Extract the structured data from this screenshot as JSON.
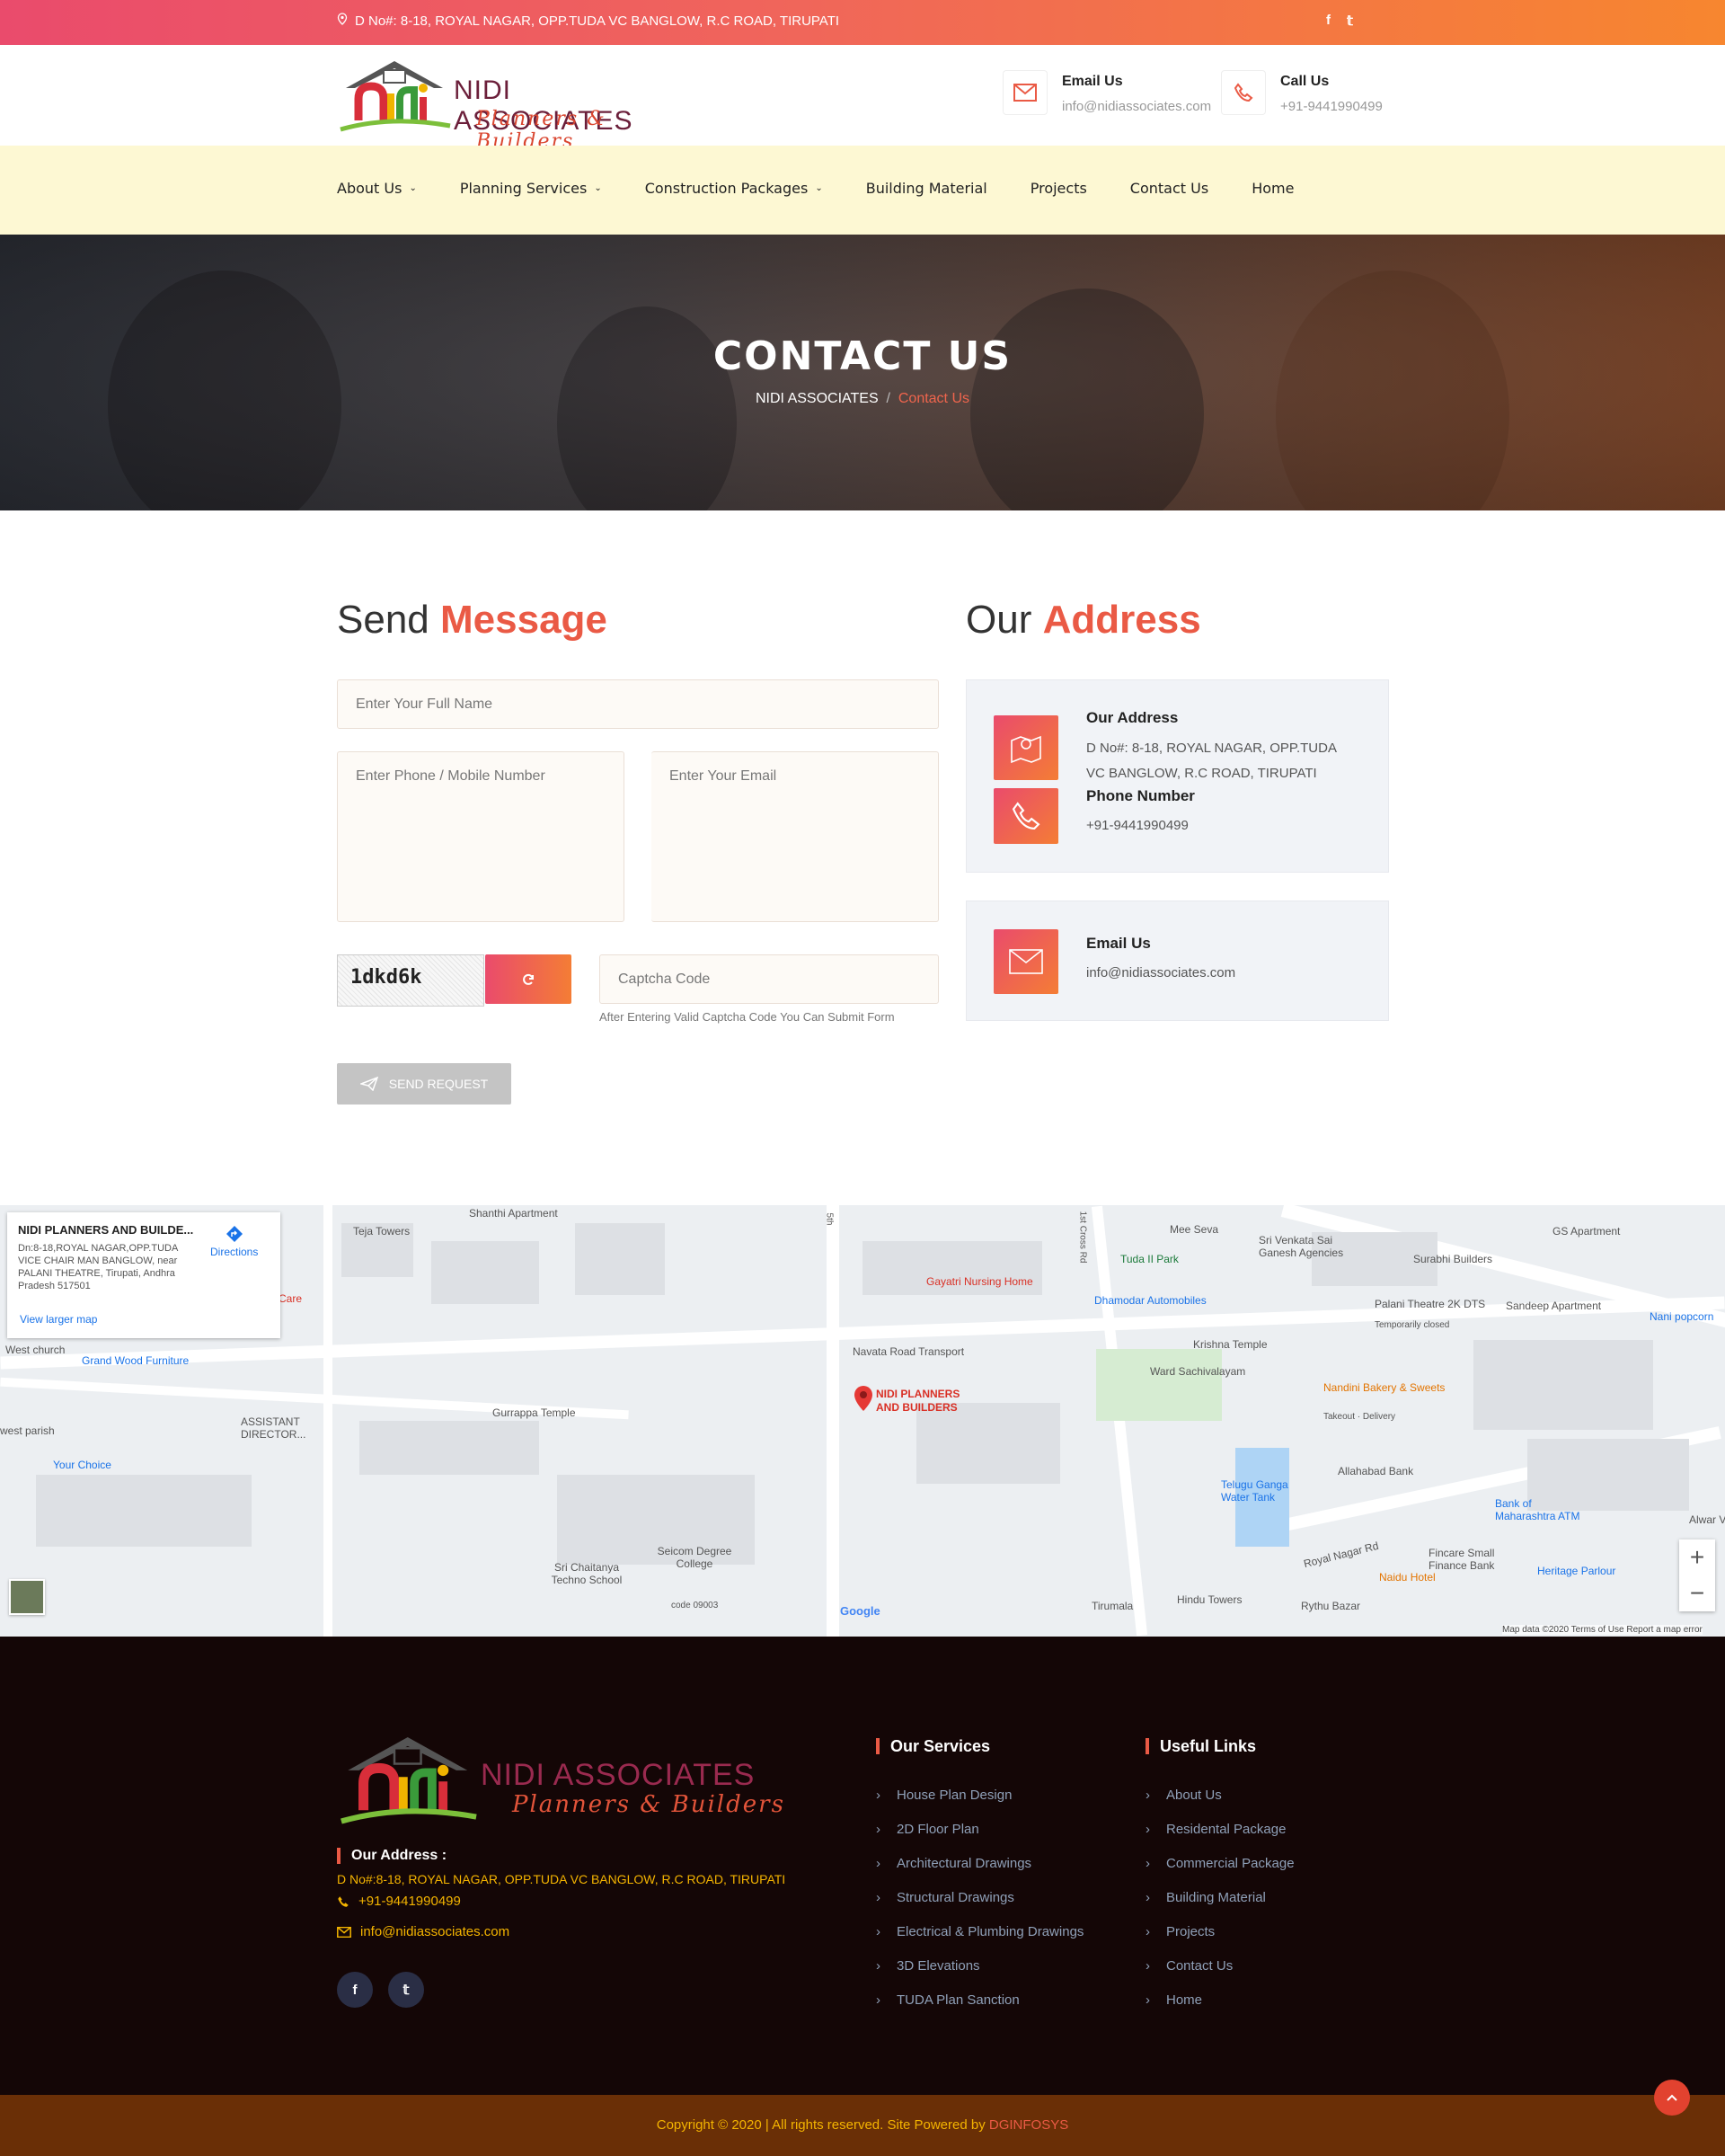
{
  "topbar": {
    "address": "D No#: 8-18, ROYAL NAGAR, OPP.TUDA VC BANGLOW, R.C ROAD, TIRUPATI",
    "facebook": "f",
    "twitter": "𝕥"
  },
  "header": {
    "logo_brand": "NIDI ASSOCIATES",
    "logo_tag": "Planners & Builders",
    "email_label": "Email Us",
    "email_value": "info@nidiassociates.com",
    "call_label": "Call Us",
    "call_value": "+91-9441990499"
  },
  "nav": {
    "items": [
      {
        "label": "About Us",
        "caret": "⌄"
      },
      {
        "label": "Planning Services",
        "caret": "⌄"
      },
      {
        "label": "Construction Packages",
        "caret": "⌄"
      },
      {
        "label": "Building Material"
      },
      {
        "label": "Projects"
      },
      {
        "label": "Contact Us"
      },
      {
        "label": "Home"
      }
    ]
  },
  "hero": {
    "title": "CONTACT US",
    "crumb_home": "NIDI ASSOCIATES",
    "crumb_sep": "/",
    "crumb_current": "Contact Us"
  },
  "form": {
    "heading_plain": "Send",
    "heading_accent": "Message",
    "name_placeholder": "Enter Your Full Name",
    "phone_placeholder": "Enter Phone / Mobile Number",
    "email_placeholder": "Enter Your Email",
    "captcha_text": "1dkd6k",
    "captcha_placeholder": "Captcha Code",
    "captcha_hint": "After Entering Valid Captcha Code You Can Submit Form",
    "send_label": "SEND REQUEST"
  },
  "address": {
    "heading_plain": "Our",
    "heading_accent": "Address",
    "addr_title": "Our Address",
    "addr_line1": "D No#: 8-18, ROYAL NAGAR, OPP.TUDA",
    "addr_line2": "VC BANGLOW, R.C ROAD, TIRUPATI",
    "phone_title": "Phone Number",
    "phone_value": "+91-9441990499",
    "email_title": "Email Us",
    "email_value": "info@nidiassociates.com"
  },
  "map": {
    "card_name": "NIDI PLANNERS AND BUILDE...",
    "card_address": "Dn:8-18,ROYAL NAGAR,OPP.TUDA VICE CHAIR MAN BANGLOW, near PALANI THEATRE, Tirupati, Andhra Pradesh 517501",
    "directions": "Directions",
    "larger_map": "View larger map",
    "pin_label_1": "NIDI PLANNERS",
    "pin_label_2": "AND BUILDERS",
    "zoom_in": "+",
    "zoom_out": "−",
    "attribution": "Map data ©2020   Terms of Use   Report a map error",
    "google": "Google",
    "labels": [
      "Shanthi Apartment",
      "Teja Towers",
      "Gayatri Nursing Home",
      "Mee Seva",
      "Tuda II Park",
      "Sri Venkata Sai Ganesh Agencies",
      "Surabhi Builders",
      "GS Apartment",
      "Dhamodar Automobiles",
      "Palani Theatre 2K DTS",
      "Temporarily closed",
      "Sandeep Apartment",
      "Nani popcorn",
      "West church",
      "Grand Wood Furniture",
      "Navata Road Transport",
      "Krishna Temple",
      "Ward Sachivalayam",
      "Nandini Bakery & Sweets",
      "Takeout · Delivery",
      "Gurrappa Temple",
      "ASSISTANT DIRECTOR...",
      "west parish",
      "Your Choice",
      "Telugu Ganga Water Tank",
      "Allahabad Bank",
      "Bank of Maharashtra ATM",
      "Alwar V",
      "Seicom Degree College",
      "Sri Chaitanya Techno School",
      "code 09003",
      "Royal Nagar Rd",
      "Fincare Small Finance Bank",
      "Heritage Parlour",
      "Hindu Towers",
      "Rythu Bazar",
      "Tirumala",
      "Naidu Hotel",
      "Care",
      "1st Cross Rd",
      "5th"
    ]
  },
  "footer": {
    "logo_brand": "NIDI ASSOCIATES",
    "logo_tag": "Planners & Builders",
    "addr_title": "Our Address :",
    "addr_value": "D No#:8-18, ROYAL NAGAR, OPP.TUDA VC BANGLOW, R.C ROAD, TIRUPATI",
    "phone": "+91-9441990499",
    "email": "info@nidiassociates.com",
    "services_title": "Our Services",
    "services": [
      "House Plan Design",
      "2D Floor Plan",
      "Architectural Drawings",
      "Structural Drawings",
      "Electrical & Plumbing Drawings",
      "3D Elevations",
      "TUDA Plan Sanction"
    ],
    "links_title": "Useful Links",
    "links": [
      "About Us",
      "Residental Package",
      "Commercial Package",
      "Building Material",
      "Projects",
      "Contact Us",
      "Home"
    ],
    "facebook": "f",
    "twitter": "𝕥"
  },
  "copyright": {
    "text": "Copyright © 2020 | All rights reserved. Site Powered by",
    "powered": "DGINFOSYS"
  },
  "colors": {
    "accent": "#ea5a45",
    "gradient_start": "#ea4b6c",
    "gradient_end": "#f7862f",
    "nav_bg": "#fdf8d3",
    "footer_bg": "#140606",
    "copyright_bg": "#6a2f06",
    "footer_text_yellow": "#f4b400"
  }
}
